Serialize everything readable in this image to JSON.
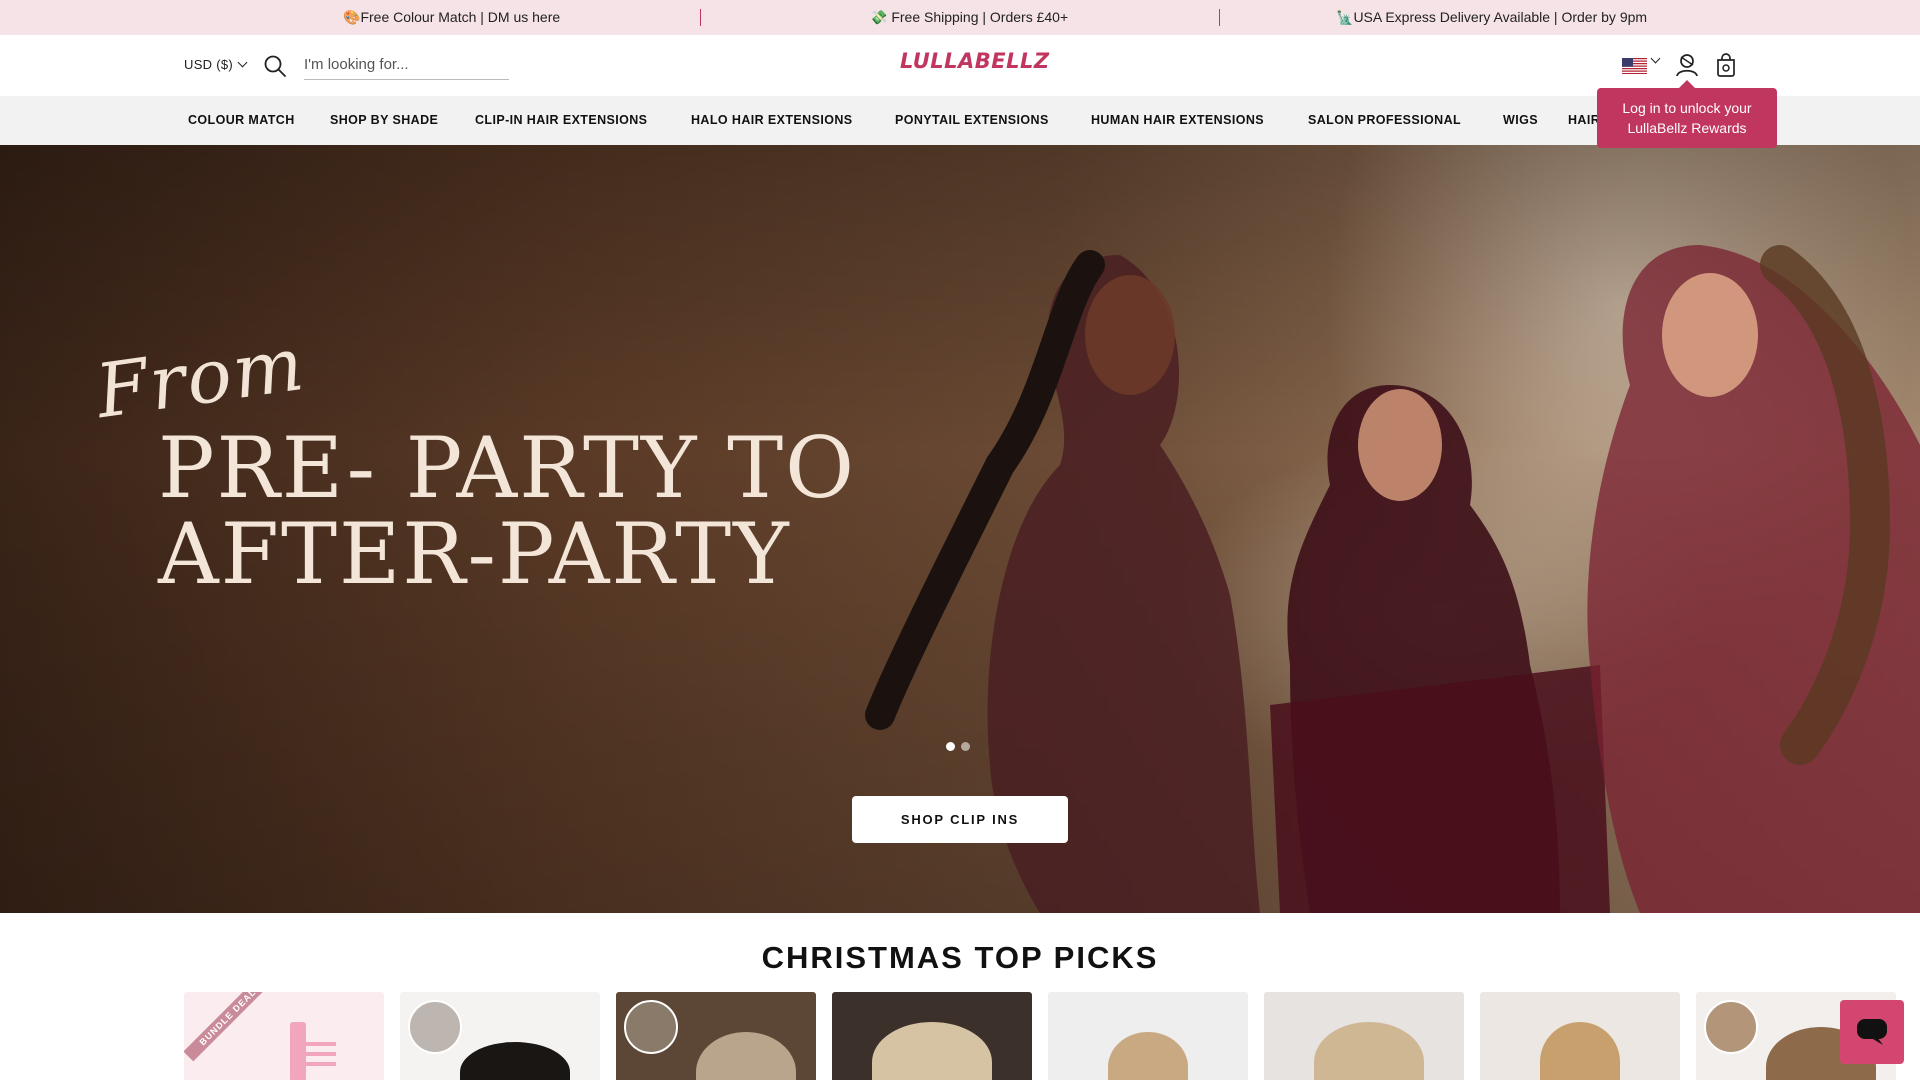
{
  "announcement": {
    "messages": [
      {
        "emoji": "🎨",
        "text": "Free Colour Match | DM us here"
      },
      {
        "emoji": "💸",
        "text": "Free Shipping | Orders £40+"
      },
      {
        "emoji": "🗽",
        "text": "USA Express Delivery Available | Order by 9pm"
      }
    ]
  },
  "header": {
    "currency": "USD ($)",
    "search_placeholder": "I'm looking for...",
    "logo": "LULLABELLZ",
    "country_flag": "us-flag-icon",
    "icons": [
      "search-icon",
      "account-icon",
      "bag-icon"
    ]
  },
  "tooltip": {
    "text_line1": "Log in to unlock your",
    "text_line2": "LullaBellz Rewards"
  },
  "nav": {
    "items": [
      "COLOUR MATCH",
      "SHOP BY SHADE",
      "CLIP-IN HAIR EXTENSIONS",
      "HALO HAIR EXTENSIONS",
      "PONYTAIL EXTENSIONS",
      "HUMAN HAIR EXTENSIONS",
      "SALON PROFESSIONAL",
      "WIGS",
      "HAIR"
    ]
  },
  "hero": {
    "script_text": "From",
    "headline_line1": "PRE- PARTY TO",
    "headline_line2": "AFTER-PARTY",
    "cta_label": "SHOP CLIP INS",
    "slides_count": 2,
    "active_slide": 1
  },
  "section": {
    "title": "CHRISTMAS TOP PICKS",
    "first_card_badge": "BUNDLE DEAL",
    "card_count": 8
  },
  "colors": {
    "brand": "#c0365f",
    "announcement_bg": "#f6e3e7",
    "nav_bg": "#f2f2f2",
    "chat": "#d2466f"
  }
}
